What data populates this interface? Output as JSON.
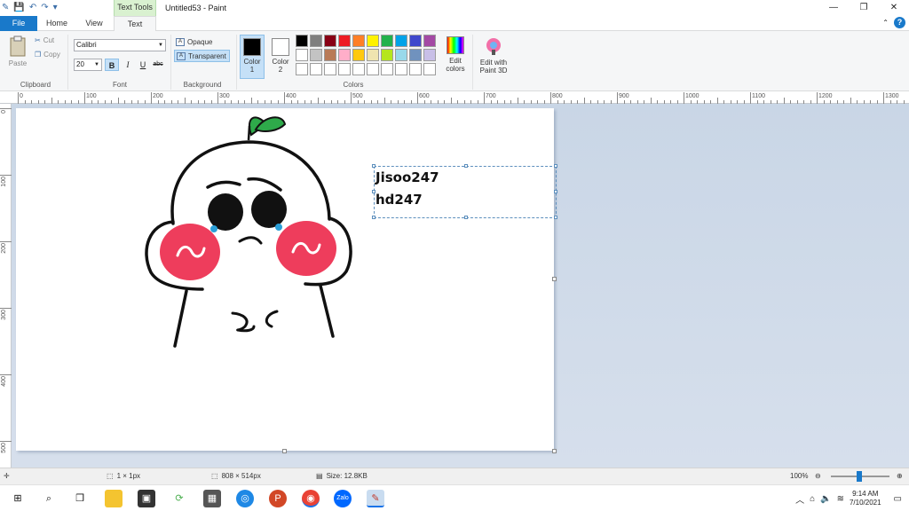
{
  "titlebar": {
    "context_tab": "Text Tools",
    "title": "Untitled53 - Paint",
    "minimize": "—",
    "restore": "❐",
    "close": "✕"
  },
  "tabs": {
    "file": "File",
    "home": "Home",
    "view": "View",
    "text": "Text"
  },
  "ribbon": {
    "clipboard": {
      "paste": "Paste",
      "cut": "Cut",
      "copy": "Copy",
      "label": "Clipboard"
    },
    "font": {
      "family": "Calibri",
      "size": "20",
      "bold": "B",
      "italic": "I",
      "underline": "U",
      "strike": "abc",
      "label": "Font"
    },
    "background": {
      "opaque": "Opaque",
      "transparent": "Transparent",
      "label": "Background"
    },
    "colors": {
      "color1_label": "Color",
      "color1_num": "1",
      "color2_label": "Color",
      "color2_num": "2",
      "color1": "#000000",
      "color2": "#ffffff",
      "label": "Colors",
      "edit_colors_1": "Edit",
      "edit_colors_2": "colors",
      "paint3d_1": "Edit with",
      "paint3d_2": "Paint 3D",
      "palette": [
        "#000000",
        "#7f7f7f",
        "#880015",
        "#ed1c24",
        "#ff7f27",
        "#fff200",
        "#22b14c",
        "#00a2e8",
        "#3f48cc",
        "#a349a4",
        "#ffffff",
        "#c3c3c3",
        "#b97a57",
        "#ffaec9",
        "#ffc90e",
        "#efe4b0",
        "#b5e61d",
        "#99d9ea",
        "#7092be",
        "#c8bfe7",
        "#ffffff",
        "#ffffff",
        "#ffffff",
        "#ffffff",
        "#ffffff",
        "#ffffff",
        "#ffffff",
        "#ffffff",
        "#ffffff",
        "#ffffff"
      ]
    }
  },
  "ruler": {
    "top": [
      "0",
      "100",
      "200",
      "300",
      "400",
      "500",
      "600",
      "700",
      "800",
      "900",
      "1000",
      "1100",
      "1200",
      "1300"
    ],
    "left": [
      "0",
      "100",
      "200",
      "300",
      "400",
      "500"
    ]
  },
  "canvas": {
    "text_line1": "Jisoo247",
    "text_line2": "hd247"
  },
  "statusbar": {
    "selection": "1 × 1px",
    "dimensions": "808 × 514px",
    "size": "Size: 12.8KB",
    "zoom": "100%"
  },
  "taskbar": {
    "time": "9:14 AM",
    "date": "7/10/2021"
  }
}
